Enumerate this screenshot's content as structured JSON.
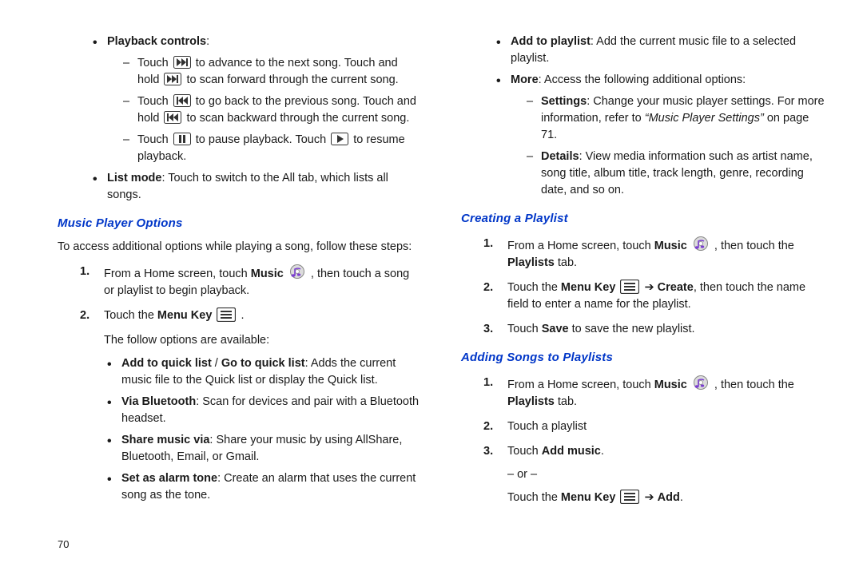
{
  "page_number": "70",
  "left": {
    "pb_heading": "Playback controls",
    "pb1a": "Touch ",
    "pb1b": " to advance to the next song. Touch and hold ",
    "pb1c": " to scan forward through the current song.",
    "pb2a": "Touch ",
    "pb2b": " to go back to the previous song. Touch and hold ",
    "pb2c": " to scan backward through the current song.",
    "pb3a": "Touch ",
    "pb3b": " to pause playback. Touch ",
    "pb3c": " to resume playback.",
    "listmode_b": "List mode",
    "listmode_t": ": Touch to switch to the All tab, which lists all songs.",
    "h_options": "Music Player Options",
    "intro": "To access additional options while playing a song, follow these steps:",
    "s1a": "From a Home screen, touch ",
    "s1b": "Music",
    "s1c": ", then touch a song or playlist to begin playback.",
    "s2a": "Touch the ",
    "s2b": "Menu Key",
    "s2c": ".",
    "s2d": "The follow options are available:",
    "opt1b": "Add to quick list",
    "opt1s": " / ",
    "opt1b2": "Go to quick list",
    "opt1t": ": Adds the current music file to the Quick list or display the Quick list.",
    "opt2b": "Via Bluetooth",
    "opt2t": ": Scan for devices and pair with a Bluetooth headset.",
    "opt3b": "Share music via",
    "opt3t": ": Share your music by using AllShare, Bluetooth, Email, or Gmail.",
    "opt4b": "Set as alarm tone",
    "opt4t": ": Create an alarm that uses the current song as the tone."
  },
  "right": {
    "opt5b": "Add to playlist",
    "opt5t": ": Add the current music file to a selected playlist.",
    "opt6b": "More",
    "opt6t": ": Access the following additional options:",
    "more1b": "Settings",
    "more1t": ": Change your music player settings. For more information, refer to ",
    "more1i": "“Music Player Settings”",
    "more1p": " on page 71.",
    "more2b": "Details",
    "more2t": ": View media information such as artist name, song title, album title, track length, genre, recording date, and so on.",
    "h_create": "Creating a Playlist",
    "c1a": "From a Home screen, touch ",
    "c1b": "Music",
    "c1c": ", then touch the ",
    "c1d": "Playlists",
    "c1e": " tab.",
    "c2a": "Touch the ",
    "c2b": "Menu Key",
    "c2c": " ➔ ",
    "c2d": "Create",
    "c2e": ", then touch the name field to enter a name for the playlist.",
    "c3a": "Touch ",
    "c3b": "Save",
    "c3c": " to save the new playlist.",
    "h_add": "Adding Songs to Playlists",
    "a1a": "From a Home screen, touch ",
    "a1b": "Music",
    "a1c": ", then touch the ",
    "a1d": "Playlists",
    "a1e": " tab.",
    "a2": "Touch a playlist",
    "a3a": "Touch ",
    "a3b": "Add music",
    "a3c": ".",
    "a3or": "– or –",
    "a3d": "Touch the ",
    "a3e": "Menu Key",
    "a3f": " ➔ ",
    "a3g": "Add",
    "a3h": "."
  }
}
